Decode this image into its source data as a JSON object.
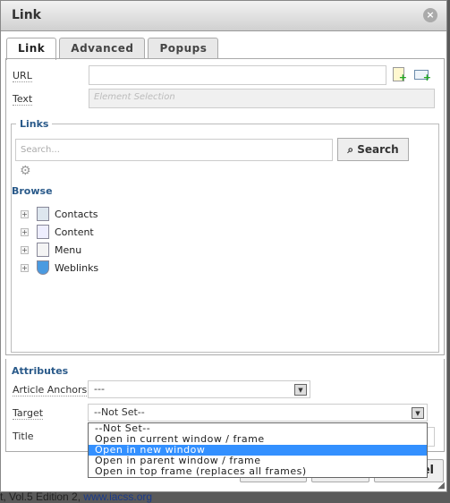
{
  "background": {
    "text": "t, Vol.5 Edition 2, ",
    "link": "www.iacss.org"
  },
  "dialog": {
    "title": "Link",
    "close_icon": "close-circle-icon"
  },
  "tabs": [
    {
      "label": "Link",
      "active": true
    },
    {
      "label": "Advanced"
    },
    {
      "label": "Popups"
    }
  ],
  "url": {
    "label": "URL",
    "value": ""
  },
  "text": {
    "label": "Text",
    "placeholder": "Element Selection"
  },
  "links": {
    "legend": "Links",
    "search_placeholder": "Search...",
    "search_button": "Search",
    "browse": "Browse",
    "tree": [
      {
        "label": "Contacts"
      },
      {
        "label": "Content"
      },
      {
        "label": "Menu"
      },
      {
        "label": "Weblinks"
      }
    ]
  },
  "attributes": {
    "heading": "Attributes",
    "anchors_label": "Article Anchors",
    "anchors_value": "---",
    "target_label": "Target",
    "target_value": "--Not Set--",
    "title_label": "Title",
    "target_options": [
      "--Not Set--",
      "Open in current window / frame",
      "Open in new window",
      "Open in parent window / frame",
      "Open in top frame (replaces all frames)"
    ],
    "selected_option": 2
  },
  "footer": {
    "cancel_partial": "el"
  }
}
